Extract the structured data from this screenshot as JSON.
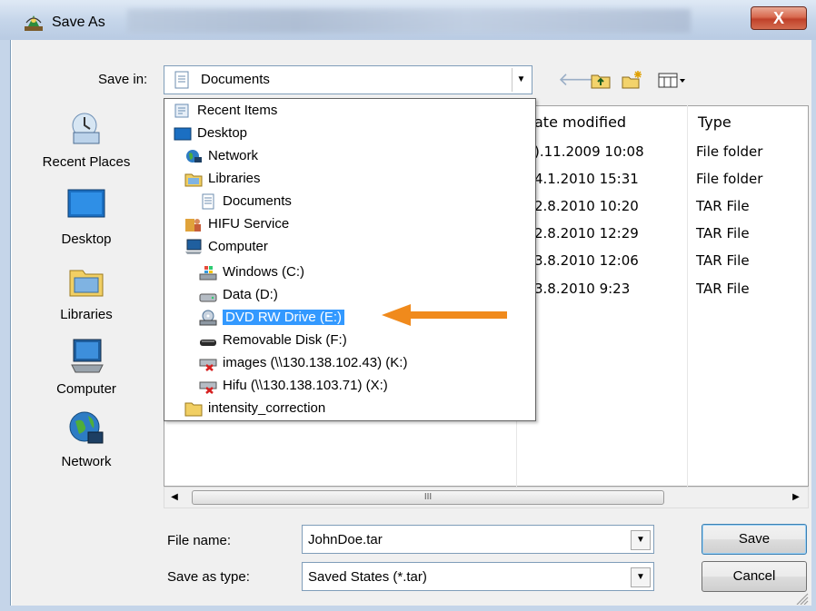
{
  "window": {
    "title": "Save As",
    "close_label": "X"
  },
  "toolbar": {
    "save_in_label": "Save in:",
    "save_in_value": "Documents",
    "icons": [
      "back-arrow-icon",
      "up-folder-icon",
      "new-folder-icon",
      "view-menu-icon"
    ]
  },
  "places": [
    {
      "label": "Recent Places",
      "icon": "recent-places-icon"
    },
    {
      "label": "Desktop",
      "icon": "desktop-icon"
    },
    {
      "label": "Libraries",
      "icon": "libraries-icon"
    },
    {
      "label": "Computer",
      "icon": "computer-icon"
    },
    {
      "label": "Network",
      "icon": "network-icon"
    }
  ],
  "file_list": {
    "columns": [
      "ate modified",
      "Type"
    ],
    "rows": [
      {
        "date": ").11.2009 10:08",
        "type": "File folder"
      },
      {
        "date": "4.1.2010 15:31",
        "type": "File folder"
      },
      {
        "date": "2.8.2010 10:20",
        "type": "TAR File"
      },
      {
        "date": "2.8.2010 12:29",
        "type": "TAR File"
      },
      {
        "date": "3.8.2010 12:06",
        "type": "TAR File"
      },
      {
        "date": "3.8.2010 9:23",
        "type": "TAR File"
      }
    ]
  },
  "dropdown": {
    "items": [
      {
        "label": "Recent Items",
        "icon": "recent-items-icon"
      },
      {
        "label": "Desktop",
        "icon": "desktop-icon"
      },
      {
        "label": "Network",
        "icon": "network-icon"
      },
      {
        "label": "Libraries",
        "icon": "libraries-icon"
      },
      {
        "label": "Documents",
        "icon": "document-icon"
      },
      {
        "label": "HIFU Service",
        "icon": "user-folder-icon"
      },
      {
        "label": "Computer",
        "icon": "computer-icon"
      },
      {
        "label": "Windows (C:)",
        "icon": "windows-drive-icon"
      },
      {
        "label": "Data (D:)",
        "icon": "hard-drive-icon"
      },
      {
        "label": "DVD RW Drive (E:)",
        "icon": "dvd-drive-icon",
        "selected": true
      },
      {
        "label": "Removable Disk (F:)",
        "icon": "removable-disk-icon"
      },
      {
        "label": "images (\\\\130.138.102.43) (K:)",
        "icon": "disconnected-network-drive-icon"
      },
      {
        "label": "Hifu (\\\\130.138.103.71) (X:)",
        "icon": "disconnected-network-drive-icon"
      },
      {
        "label": "intensity_correction",
        "icon": "folder-icon"
      }
    ]
  },
  "scroll": {
    "thumb_label": "III"
  },
  "form": {
    "file_name_label": "File name:",
    "file_name_value": "JohnDoe.tar",
    "save_type_label": "Save as type:",
    "save_type_value": "Saved States (*.tar)"
  },
  "buttons": {
    "save": "Save",
    "cancel": "Cancel"
  },
  "colors": {
    "selection": "#3399ff",
    "annotation_arrow": "#f08a1c",
    "close_button": "#c9533a"
  }
}
